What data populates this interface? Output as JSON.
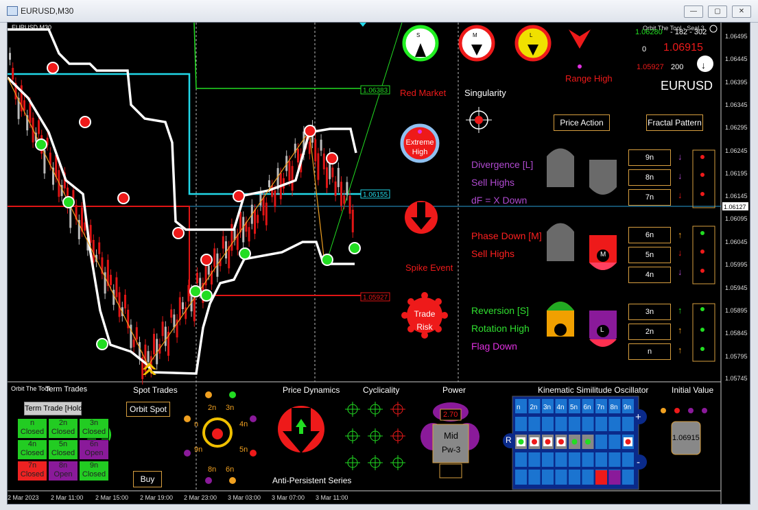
{
  "window": {
    "title": "EURUSD,M30",
    "buttons": [
      "—",
      "▢",
      "✕"
    ]
  },
  "chart": {
    "symbol_tf": "EURUSD,M30",
    "indicator_title": "Orbit The Tool - Seal 3",
    "symbol": "EURUSD",
    "bid_value": "1.06915",
    "high_value": "1.06280",
    "low_value": "1.05927",
    "spread_left": "0",
    "spread_right": "200",
    "header_stats": "- 182 - 302",
    "price_axis": [
      "1.06495",
      "1.06445",
      "1.06395",
      "1.06345",
      "1.06295",
      "1.06245",
      "1.06195",
      "1.06145",
      "1.06127",
      "1.06095",
      "1.06045",
      "1.05995",
      "1.05945",
      "1.05895",
      "1.05845",
      "1.05795",
      "1.05745"
    ],
    "time_axis": [
      "2 Mar 2023",
      "2 Mar 11:00",
      "2 Mar 15:00",
      "2 Mar 19:00",
      "2 Mar 23:00",
      "3 Mar 03:00",
      "3 Mar 07:00",
      "3 Mar 11:00"
    ],
    "line_labels": [
      "1.06383",
      "1.06155",
      "1.05927"
    ],
    "current_price_tag": "1.06127"
  },
  "signals": {
    "s_label": "S",
    "m_label": "M",
    "l_label": "L",
    "red_market": "Red Market",
    "singularity": "Singularity",
    "range_high": "Range High",
    "extreme_high": "Extreme\nHigh",
    "spike_event": "Spike Event",
    "trade_risk": "Trade\nRisk",
    "price_action_btn": "Price Action",
    "fractal_pattern_btn": "Fractal Pattern"
  },
  "panels": [
    {
      "lines": [
        "Divergence [L]",
        "Sell Highs",
        "dF = X Down"
      ],
      "colors": [
        "#b04ad0",
        "#b04ad0",
        "#b04ad0"
      ],
      "boxes": [
        "9n",
        "8n",
        "7n"
      ],
      "arrows": [
        "purple-down",
        "purple-down",
        "red-down"
      ]
    },
    {
      "lines": [
        "Phase Down [M]",
        "Sell Highs"
      ],
      "colors": [
        "#ff2020",
        "#ff2020"
      ],
      "boxes": [
        "6n",
        "5n",
        "4n"
      ],
      "arrows": [
        "orange-up",
        "red-down",
        "purple-down"
      ]
    },
    {
      "lines": [
        "Reversion [S]",
        "Rotation High",
        "Flag Down"
      ],
      "colors": [
        "#30e030",
        "#30e030",
        "#e030e0"
      ],
      "boxes": [
        "3n",
        "2n",
        "n"
      ],
      "arrows": [
        "green-up",
        "orange-up",
        "orange-up"
      ]
    }
  ],
  "bottom": {
    "orbit_title": "Orbit The Tool",
    "term_trades": "Term Trades",
    "term_trade_hold": "Term Trade [Hold]",
    "grid": [
      {
        "n": "n",
        "s": "Closed",
        "c": "#22cc22"
      },
      {
        "n": "4n",
        "s": "Closed",
        "c": "#22cc22"
      },
      {
        "n": "7n",
        "s": "Closed",
        "c": "#ee2222"
      },
      {
        "n": "2n",
        "s": "Closed",
        "c": "#22cc22"
      },
      {
        "n": "5n",
        "s": "Closed",
        "c": "#22cc22"
      },
      {
        "n": "8n",
        "s": "Open",
        "c": "#8a1a9a"
      },
      {
        "n": "3n",
        "s": "Closed",
        "c": "#22cc22"
      },
      {
        "n": "6n",
        "s": "Open",
        "c": "#8a1a9a"
      },
      {
        "n": "9n",
        "s": "Closed",
        "c": "#22cc22"
      }
    ],
    "spot_trades": "Spot Trades",
    "orbit_spot": "Orbit Spot",
    "buy": "Buy",
    "orbit_labels": [
      "2n",
      "3n",
      "n",
      "4n",
      "9n",
      "5n",
      "8n",
      "6n"
    ],
    "price_dynamics": "Price Dynamics",
    "anti_persistent": "Anti-Persistent Series",
    "cyclicality": "Cyclicality",
    "power": "Power",
    "power_value": "2.70",
    "power_mid": "Mid",
    "power_pw": "Pw-3",
    "power_r": "R",
    "kso_title": "Kinematic Similitude Oscillator",
    "kso_header": [
      "n",
      "2n",
      "3n",
      "4n",
      "5n",
      "6n",
      "7n",
      "8n",
      "9n"
    ],
    "initial_value_title": "Initial Value",
    "initial_value": "1.06915"
  }
}
